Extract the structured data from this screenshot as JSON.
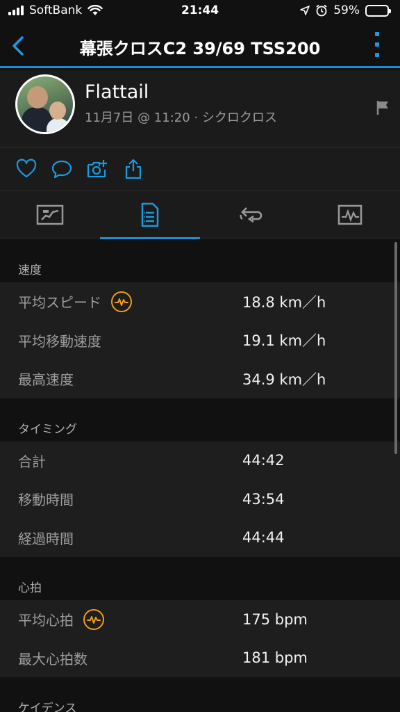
{
  "status": {
    "carrier": "SoftBank",
    "time": "21:44",
    "battery": "59%",
    "battery_level": 0.59
  },
  "header": {
    "title": "幕張クロスC2 39/69 TSS200"
  },
  "profile": {
    "name": "Flattail",
    "meta": "11月7日 @ 11:20 · シクロクロス"
  },
  "colors": {
    "accent": "#1a8fd6",
    "badge": "#f29a1d"
  },
  "sections": [
    {
      "title": "速度",
      "rows": [
        {
          "label": "平均スピード",
          "value": "18.8 km／h",
          "badge": true
        },
        {
          "label": "平均移動速度",
          "value": "19.1 km／h",
          "badge": false
        },
        {
          "label": "最高速度",
          "value": "34.9 km／h",
          "badge": false
        }
      ]
    },
    {
      "title": "タイミング",
      "rows": [
        {
          "label": "合計",
          "value": "44:42",
          "badge": false
        },
        {
          "label": "移動時間",
          "value": "43:54",
          "badge": false
        },
        {
          "label": "経過時間",
          "value": "44:44",
          "badge": false
        }
      ]
    },
    {
      "title": "心拍",
      "rows": [
        {
          "label": "平均心拍",
          "value": "175 bpm",
          "badge": true
        },
        {
          "label": "最大心拍数",
          "value": "181 bpm",
          "badge": false
        }
      ]
    },
    {
      "title": "ケイデンス",
      "rows": []
    }
  ]
}
